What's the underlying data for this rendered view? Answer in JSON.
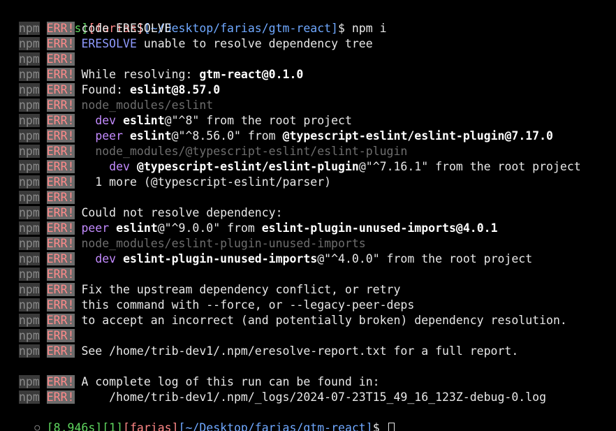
{
  "terminal": {
    "prompt1": {
      "status_icon": "⊗",
      "status_icon_name": "error-status-icon",
      "time": "[36ms]",
      "user": "[farias]",
      "path": "[~/Desktop/farias/gtm-react]",
      "symbol": "$",
      "command": " npm i"
    },
    "npm_label": "npm",
    "err_label": "ERR!",
    "lines": [
      {
        "segments": [
          {
            "t": "code ERESOLVE",
            "s": "msg"
          }
        ]
      },
      {
        "segments": [
          {
            "t": "ERESOLVE",
            "s": "blue"
          },
          {
            "t": " unable to resolve dependency tree",
            "s": "msg"
          }
        ]
      },
      {
        "segments": []
      },
      {
        "segments": [
          {
            "t": "While resolving: ",
            "s": "msg"
          },
          {
            "t": "gtm-react@0.1.0",
            "s": "bold"
          }
        ]
      },
      {
        "segments": [
          {
            "t": "Found: ",
            "s": "msg"
          },
          {
            "t": "eslint@8.57.0",
            "s": "bold"
          }
        ]
      },
      {
        "segments": [
          {
            "t": "node_modules/eslint",
            "s": "dim"
          }
        ]
      },
      {
        "segments": [
          {
            "t": "  ",
            "s": "msg"
          },
          {
            "t": "dev",
            "s": "mag"
          },
          {
            "t": " ",
            "s": "msg"
          },
          {
            "t": "eslint",
            "s": "bold"
          },
          {
            "t": "@\"^8\" from the root project",
            "s": "msg"
          }
        ]
      },
      {
        "segments": [
          {
            "t": "  ",
            "s": "msg"
          },
          {
            "t": "peer",
            "s": "mag"
          },
          {
            "t": " ",
            "s": "msg"
          },
          {
            "t": "eslint",
            "s": "bold"
          },
          {
            "t": "@\"^8.56.0\" from ",
            "s": "msg"
          },
          {
            "t": "@typescript-eslint/eslint-plugin@7.17.0",
            "s": "bold"
          }
        ]
      },
      {
        "segments": [
          {
            "t": "  ",
            "s": "msg"
          },
          {
            "t": "node_modules/@typescript-eslint/eslint-plugin",
            "s": "dim"
          }
        ]
      },
      {
        "segments": [
          {
            "t": "    ",
            "s": "msg"
          },
          {
            "t": "dev",
            "s": "mag"
          },
          {
            "t": " ",
            "s": "msg"
          },
          {
            "t": "@typescript-eslint/eslint-plugin",
            "s": "bold"
          },
          {
            "t": "@\"^7.16.1\" from the root project",
            "s": "msg"
          }
        ]
      },
      {
        "segments": [
          {
            "t": "  1 more (@typescript-eslint/parser)",
            "s": "msg"
          }
        ]
      },
      {
        "segments": []
      },
      {
        "segments": [
          {
            "t": "Could not resolve dependency:",
            "s": "msg"
          }
        ]
      },
      {
        "segments": [
          {
            "t": "peer",
            "s": "mag"
          },
          {
            "t": " ",
            "s": "msg"
          },
          {
            "t": "eslint",
            "s": "bold"
          },
          {
            "t": "@\"^9.0.0\" from ",
            "s": "msg"
          },
          {
            "t": "eslint-plugin-unused-imports@4.0.1",
            "s": "bold"
          }
        ]
      },
      {
        "segments": [
          {
            "t": "node_modules/eslint-plugin-unused-imports",
            "s": "dim"
          }
        ]
      },
      {
        "segments": [
          {
            "t": "  ",
            "s": "msg"
          },
          {
            "t": "dev",
            "s": "mag"
          },
          {
            "t": " ",
            "s": "msg"
          },
          {
            "t": "eslint-plugin-unused-imports",
            "s": "bold"
          },
          {
            "t": "@\"^4.0.0\" from the root project",
            "s": "msg"
          }
        ]
      },
      {
        "segments": []
      },
      {
        "segments": [
          {
            "t": "Fix the upstream dependency conflict, or retry",
            "s": "msg"
          }
        ]
      },
      {
        "segments": [
          {
            "t": "this command with --force, or --legacy-peer-deps",
            "s": "msg"
          }
        ]
      },
      {
        "segments": [
          {
            "t": "to accept an incorrect (and potentially broken) dependency resolution.",
            "s": "msg"
          }
        ]
      },
      {
        "segments": []
      },
      {
        "segments": [
          {
            "t": "See /home/trib-dev1/.npm/eresolve-report.txt for a full report.",
            "s": "msg"
          }
        ]
      }
    ],
    "log_lines": [
      {
        "segments": [
          {
            "t": "A complete log of this run can be found in:",
            "s": "msg"
          }
        ]
      },
      {
        "segments": [
          {
            "t": "    /home/trib-dev1/.npm/_logs/2024-07-23T15_49_16_123Z-debug-0.log",
            "s": "msg"
          }
        ]
      }
    ],
    "prompt2": {
      "status_icon": "○",
      "status_icon_name": "idle-status-icon",
      "time": "[8,946s]",
      "count": "[1]",
      "user": "[farias]",
      "path": "[~/Desktop/farias/gtm-react]",
      "symbol": "$"
    }
  }
}
